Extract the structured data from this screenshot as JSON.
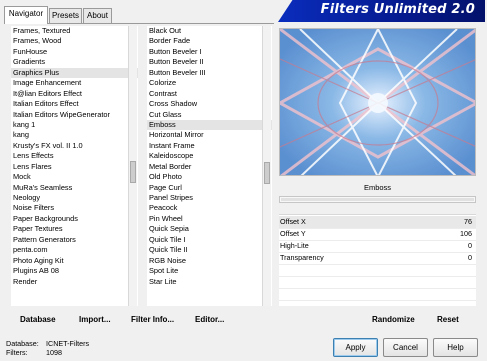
{
  "tabs": [
    "Navigator",
    "Presets",
    "About"
  ],
  "banner_title": "Filters Unlimited 2.0",
  "categories": [
    "Frames, Textured",
    "Frames, Wood",
    "FunHouse",
    "Gradients",
    "Graphics Plus",
    "Image Enhancement",
    "It@lian Editors Effect",
    "Italian Editors Effect",
    "Italian Editors WipeGenerator",
    "kang 1",
    "kang",
    "Krusty's FX vol. II 1.0",
    "Lens Effects",
    "Lens Flares",
    "Mock",
    "MuRa's Seamless",
    "Neology",
    "Noise Filters",
    "Paper Backgrounds",
    "Paper Textures",
    "Pattern Generators",
    "penta.com",
    "Photo Aging Kit",
    "Plugins AB 08",
    "Render"
  ],
  "categories_selected": "Graphics Plus",
  "filters": [
    "Black Out",
    "Border Fade",
    "Button Beveler I",
    "Button Beveler II",
    "Button Beveler III",
    "Colorize",
    "Contrast",
    "Cross Shadow",
    "Cut Glass",
    "Emboss",
    "Horizontal Mirror",
    "Instant Frame",
    "Kaleidoscope",
    "Metal Border",
    "Old Photo",
    "Page Curl",
    "Panel Stripes",
    "Peacock",
    "Pin Wheel",
    "Quick Sepia",
    "Quick Tile I",
    "Quick Tile II",
    "RGB Noise",
    "Spot Lite",
    "Star Lite"
  ],
  "filters_selected": "Emboss",
  "filter_name": "Emboss",
  "params": [
    {
      "label": "Offset X",
      "value": "76"
    },
    {
      "label": "Offset Y",
      "value": "106"
    },
    {
      "label": "High-Lite",
      "value": "0"
    },
    {
      "label": "Transparency",
      "value": "0"
    }
  ],
  "links": {
    "database": "Database",
    "import": "Import...",
    "filter_info": "Filter Info...",
    "editor": "Editor...",
    "randomize": "Randomize",
    "reset": "Reset"
  },
  "info": {
    "database_label": "Database:",
    "database_value": "ICNET-Filters",
    "filters_label": "Filters:",
    "filters_value": "1098"
  },
  "buttons": {
    "apply": "Apply",
    "cancel": "Cancel",
    "help": "Help"
  }
}
